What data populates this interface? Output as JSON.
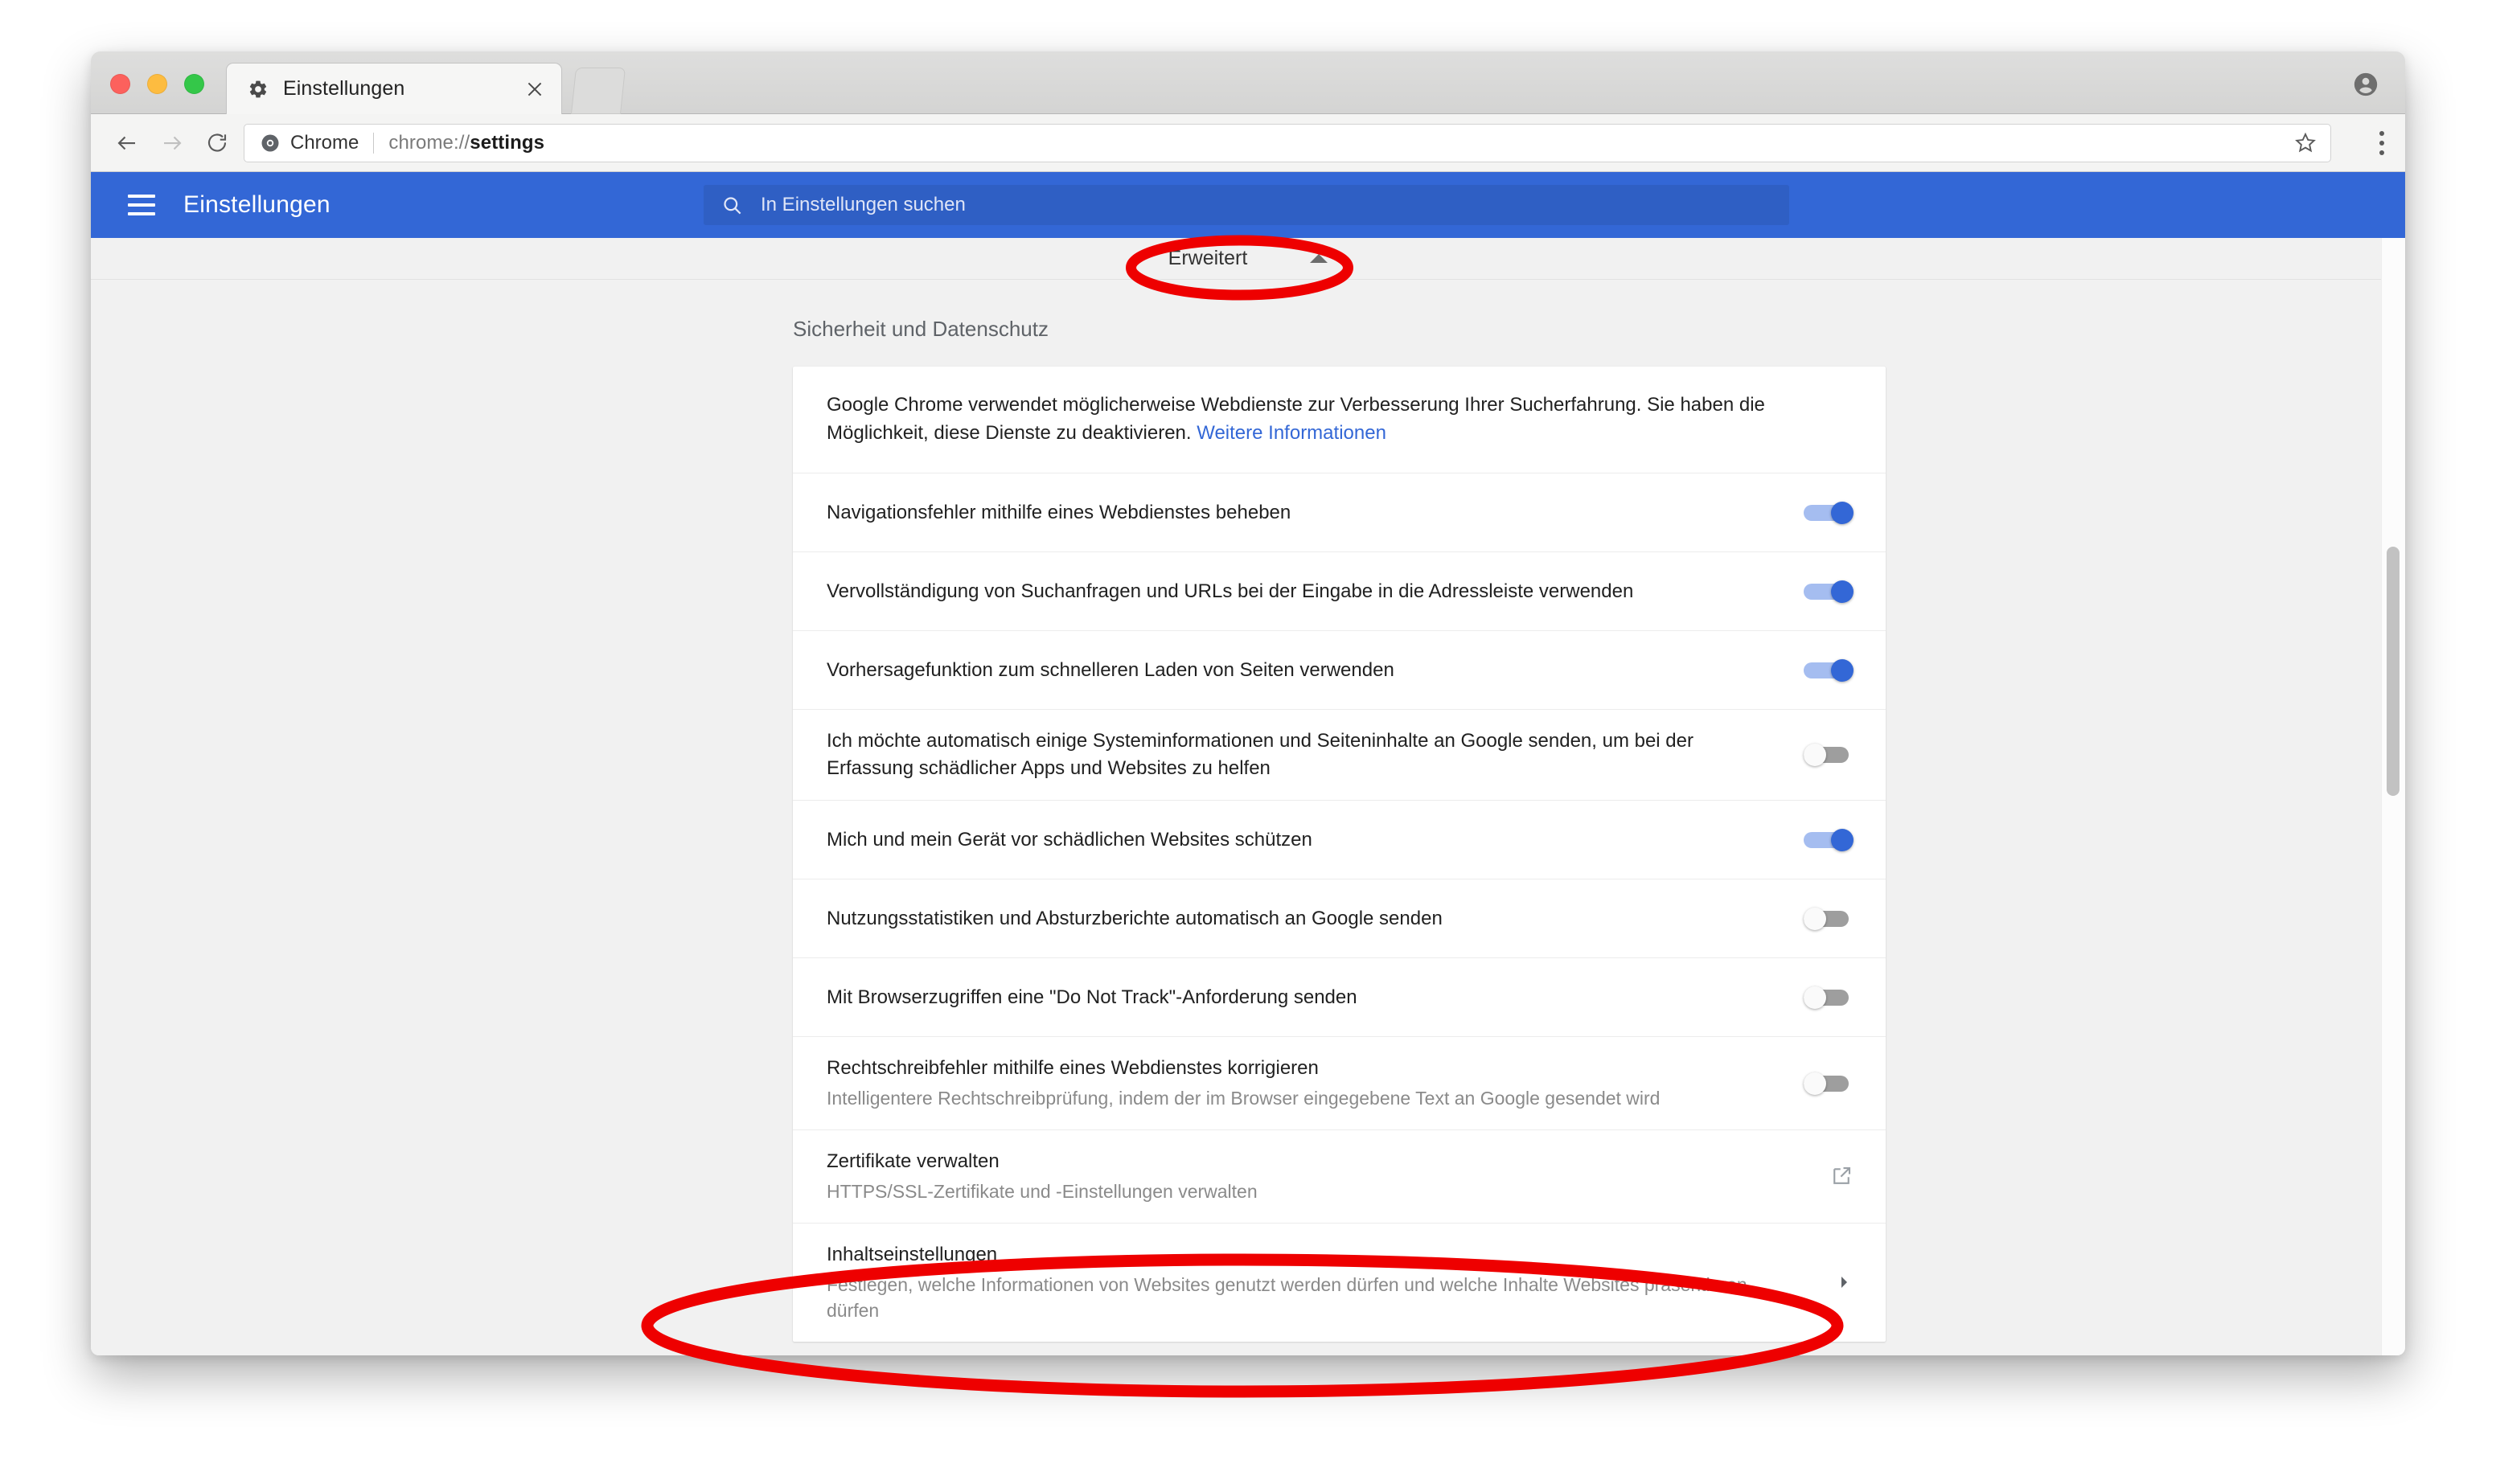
{
  "window": {
    "traffic_lights": [
      "close",
      "minimize",
      "zoom"
    ],
    "tab": {
      "title": "Einstellungen",
      "favicon": "gear-icon",
      "close": "×"
    },
    "profile_icon": "account-circle-icon"
  },
  "toolbar": {
    "back": "back-arrow-icon",
    "forward": "forward-arrow-icon",
    "reload": "reload-icon",
    "omnibox": {
      "origin_icon": "chrome-logo-icon",
      "origin": "Chrome",
      "url_prefix": "chrome://",
      "url_bold": "settings",
      "bookmark": "star-icon"
    },
    "menu": "three-dot-menu-icon"
  },
  "settings_header": {
    "menu_icon": "hamburger-icon",
    "title": "Einstellungen",
    "search": {
      "icon": "search-icon",
      "placeholder": "In Einstellungen suchen",
      "value": ""
    }
  },
  "advanced": {
    "label": "Erweitert",
    "state": "expanded",
    "caret": "chevron-up-icon"
  },
  "section": {
    "title": "Sicherheit und Datenschutz"
  },
  "intro": {
    "text": "Google Chrome verwendet möglicherweise Webdienste zur Verbesserung Ihrer Sucherfahrung. Sie haben die Möglichkeit, diese Dienste zu deaktivieren. ",
    "link": "Weitere Informationen"
  },
  "rows": [
    {
      "label": "Navigationsfehler mithilfe eines Webdienstes beheben",
      "sub": "",
      "control": "toggle",
      "state": "on"
    },
    {
      "label": "Vervollständigung von Suchanfragen und URLs bei der Eingabe in die Adressleiste verwenden",
      "sub": "",
      "control": "toggle",
      "state": "on"
    },
    {
      "label": "Vorhersagefunktion zum schnelleren Laden von Seiten verwenden",
      "sub": "",
      "control": "toggle",
      "state": "on"
    },
    {
      "label": "Ich möchte automatisch einige Systeminformationen und Seiteninhalte an Google senden, um bei der Erfassung schädlicher Apps und Websites zu helfen",
      "sub": "",
      "control": "toggle",
      "state": "off"
    },
    {
      "label": "Mich und mein Gerät vor schädlichen Websites schützen",
      "sub": "",
      "control": "toggle",
      "state": "on"
    },
    {
      "label": "Nutzungsstatistiken und Absturzberichte automatisch an Google senden",
      "sub": "",
      "control": "toggle",
      "state": "off"
    },
    {
      "label": "Mit Browserzugriffen eine \"Do Not Track\"-Anforderung senden",
      "sub": "",
      "control": "toggle",
      "state": "off"
    },
    {
      "label": "Rechtschreibfehler mithilfe eines Webdienstes korrigieren",
      "sub": "Intelligentere Rechtschreibprüfung, indem der im Browser eingegebene Text an Google gesendet wird",
      "control": "toggle",
      "state": "off"
    },
    {
      "label": "Zertifikate verwalten",
      "sub": "HTTPS/SSL-Zertifikate und -Einstellungen verwalten",
      "control": "external-link",
      "state": ""
    },
    {
      "label": "Inhaltseinstellungen",
      "sub": "Festlegen, welche Informationen von Websites genutzt werden dürfen und welche Inhalte Websites präsentieren dürfen",
      "control": "chevron-right",
      "state": ""
    }
  ],
  "annotations": {
    "color": "#ee0000",
    "items": [
      {
        "name": "advanced-button-highlight",
        "target": "Erweitert"
      },
      {
        "name": "content-settings-highlight",
        "target": "Inhaltseinstellungen"
      }
    ]
  },
  "scrollbar": {
    "orientation": "vertical",
    "thumb_position": "middle"
  },
  "colors": {
    "settings_blue": "#3367d6",
    "toggle_on": "#3367d6",
    "toggle_off": "#9e9e9e",
    "link": "#3367d6",
    "annotation_red": "#ee0000"
  }
}
